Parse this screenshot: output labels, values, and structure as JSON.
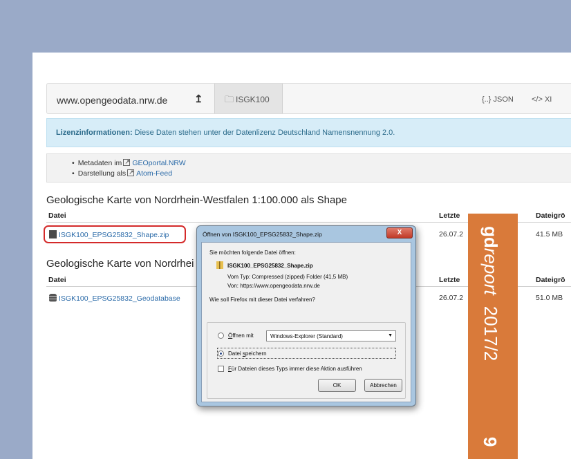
{
  "address_bar": {
    "host": "www.opengeodata.nrw.de",
    "up_arrow": "↥",
    "breadcrumb": "ISGK100",
    "json_label": "{..} JSON",
    "xml_label": "</> XI"
  },
  "licence": {
    "bold": "Lizenzinformationen:",
    "text": " Diese Daten stehen unter der Datenlizenz Deutschland Namensnennung 2.0."
  },
  "meta": {
    "item1_prefix": "Metadaten im",
    "item1_link": "GEOportal.NRW",
    "item2_prefix": "Darstellung als",
    "item2_link": "Atom-Feed"
  },
  "section1": {
    "title": "Geologische Karte von Nordrhein-Westfalen 1:100.000 als Shape",
    "col_file": "Datei",
    "col_date": "Letzte",
    "col_size": "Dateigrö",
    "rows": [
      {
        "file": "ISGK100_EPSG25832_Shape.zip",
        "date": "26.07.2",
        "size": "41.5 MB"
      }
    ]
  },
  "section2": {
    "title": "Geologische Karte von Nordrhei",
    "col_file": "Datei",
    "col_date": "Letzte",
    "col_size": "Dateigrö",
    "rows": [
      {
        "file": "ISGK100_EPSG25832_Geodatabase",
        "date": "26.07.2",
        "size": "51.0 MB"
      }
    ]
  },
  "dialog": {
    "title": "Öffnen von ISGK100_EPSG25832_Shape.zip",
    "close": "X",
    "prompt": "Sie möchten folgende Datei öffnen:",
    "filename": "ISGK100_EPSG25832_Shape.zip",
    "type_line": "Vom Typ:  Compressed (zipped) Folder (41,5 MB)",
    "from_line": "Von:  https://www.opengeodata.nrw.de",
    "question": "Wie soll Firefox mit dieser Datei verfahren?",
    "open_with_key": "Ö",
    "open_with_rest": "ffnen mit",
    "open_with_app": "Windows-Explorer (Standard)",
    "save_pre": "Datei ",
    "save_key": "s",
    "save_rest": "peichern",
    "always_key": "F",
    "always_rest": "ür Dateien dieses Typs immer diese Aktion ausführen",
    "ok": "OK",
    "cancel": "Abbrechen"
  },
  "band": {
    "gd": "gd",
    "report": "report",
    "issue": "2017/2",
    "page": "9",
    "color": "#d97a3a"
  }
}
